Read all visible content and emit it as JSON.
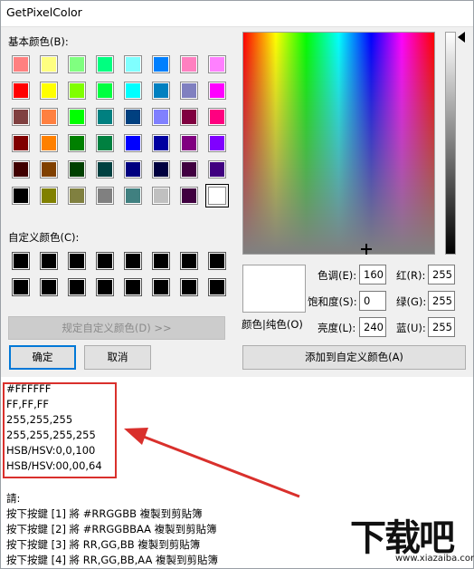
{
  "window": {
    "title": "GetPixelColor"
  },
  "dialog": {
    "basic_colors_label": "基本颜色(B):",
    "custom_colors_label": "自定义颜色(C):",
    "basic_colors": [
      "#ff8080",
      "#ffff80",
      "#80ff80",
      "#00ff80",
      "#80ffff",
      "#0080ff",
      "#ff80c0",
      "#ff80ff",
      "#ff0000",
      "#ffff00",
      "#80ff00",
      "#00ff40",
      "#00ffff",
      "#0080c0",
      "#8080c0",
      "#ff00ff",
      "#804040",
      "#ff8040",
      "#00ff00",
      "#008080",
      "#004080",
      "#8080ff",
      "#800040",
      "#ff0080",
      "#800000",
      "#ff8000",
      "#008000",
      "#008040",
      "#0000ff",
      "#0000a0",
      "#800080",
      "#8000ff",
      "#400000",
      "#804000",
      "#004000",
      "#004040",
      "#000080",
      "#000040",
      "#400040",
      "#400080",
      "#000000",
      "#808000",
      "#808040",
      "#808080",
      "#408080",
      "#c0c0c0",
      "#400040",
      "#ffffff"
    ],
    "selected_basic_index": 47,
    "custom_colors": [
      "#000000",
      "#000000",
      "#000000",
      "#000000",
      "#000000",
      "#000000",
      "#000000",
      "#000000",
      "#000000",
      "#000000",
      "#000000",
      "#000000",
      "#000000",
      "#000000",
      "#000000",
      "#000000"
    ],
    "define_custom_button": "规定自定义颜色(D) >>",
    "ok_button": "确定",
    "cancel_button": "取消",
    "color_solid_label": "颜色|纯色(O)",
    "hue_label": "色调(E):",
    "hue_value": "160",
    "sat_label": "饱和度(S):",
    "sat_value": "0",
    "lum_label": "亮度(L):",
    "lum_value": "240",
    "red_label": "红(R):",
    "red_value": "255",
    "green_label": "绿(G):",
    "green_value": "255",
    "blue_label": "蓝(U):",
    "blue_value": "255",
    "add_custom_button": "添加到自定义颜色(A)",
    "preview_color": "#ffffff"
  },
  "output": {
    "values": [
      "#FFFFFF",
      "FF,FF,FF",
      "255,255,255",
      "255,255,255,255",
      "HSB/HSV:0,0,100",
      "HSB/HSV:00,00,64"
    ],
    "instructions_header": "請:",
    "instructions": [
      "按下按鍵 [1] 將 #RRGGBB 複製到剪貼簿",
      "按下按鍵 [2] 將 #RRGGBBAA 複製到剪貼簿",
      "按下按鍵 [3] 將 RR,GG,BB 複製到剪貼簿",
      "按下按鍵 [4] 將 RR,GG,BB,AA 複製到剪貼簿"
    ]
  },
  "annotation": {
    "color": "#d9302c"
  },
  "watermark": {
    "logo_text": "下载吧",
    "url": "www.xiazaiba.com"
  }
}
